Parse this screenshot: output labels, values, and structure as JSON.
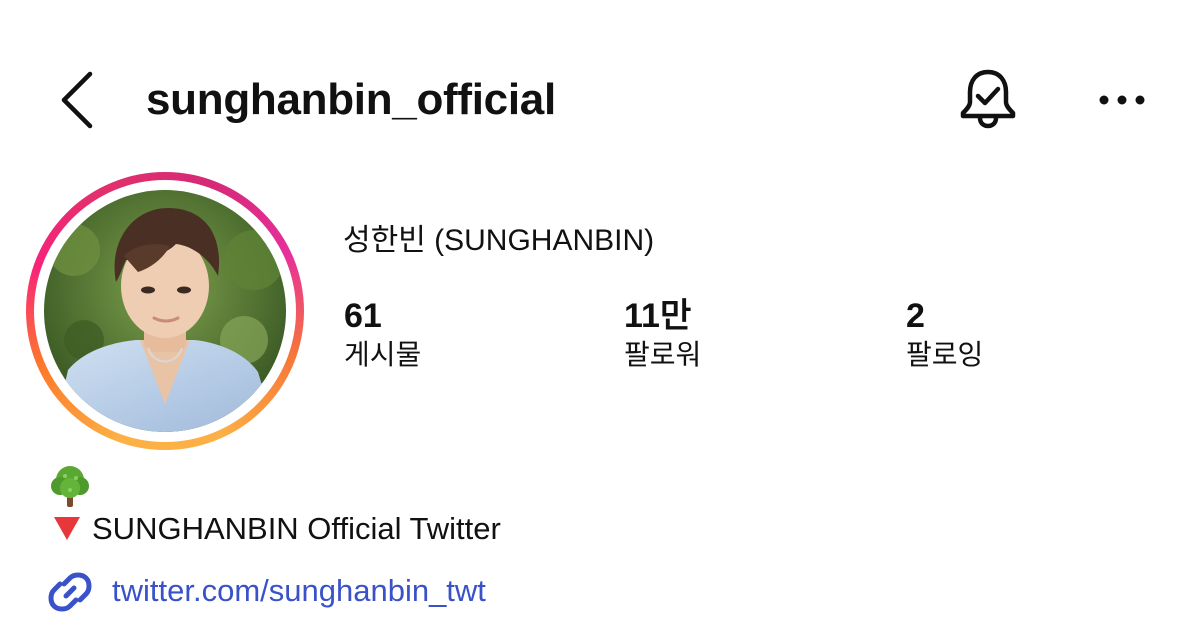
{
  "header": {
    "username": "sunghanbin_official",
    "back_icon": "chevron-left-icon",
    "notification_icon": "bell-check-icon",
    "more_icon": "more-horizontal-icon"
  },
  "profile": {
    "display_name": "성한빈 (SUNGHANBIN)",
    "avatar": "profile-photo",
    "story_ring_colors": [
      "#fcb045",
      "#f7237a",
      "#d62976"
    ]
  },
  "stats": [
    {
      "value": "61",
      "label": "게시물"
    },
    {
      "value": "11만",
      "label": "팔로워"
    },
    {
      "value": "2",
      "label": "팔로잉"
    }
  ],
  "bio": {
    "emoji_line": "🌳",
    "marker": "🔻",
    "text": "SUNGHANBIN Official Twitter",
    "link_icon": "link-icon",
    "link": "twitter.com/sunghanbin_twt",
    "link_color": "#3a52c9"
  }
}
